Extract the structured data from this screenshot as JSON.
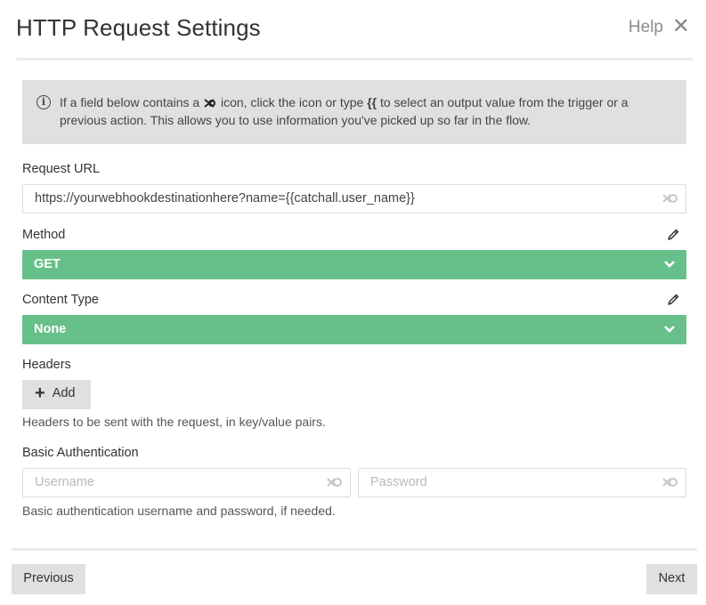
{
  "header": {
    "title": "HTTP Request Settings",
    "help_label": "Help",
    "close_glyph": "✕"
  },
  "info": {
    "text_before_icon": "If a field below contains a",
    "text_after_icon": "icon, click the icon or type",
    "brace_token": "{{",
    "text_after_braces": "to select an output value from the trigger or a previous action. This allows you to use information you've picked up so far in the flow."
  },
  "request_url": {
    "label": "Request URL",
    "value": "https://yourwebhookdestinationhere?name={{catchall.user_name}}"
  },
  "method": {
    "label": "Method",
    "selected": "GET"
  },
  "content_type": {
    "label": "Content Type",
    "selected": "None"
  },
  "headers": {
    "label": "Headers",
    "add_label": "Add",
    "hint": "Headers to be sent with the request, in key/value pairs."
  },
  "basic_auth": {
    "label": "Basic Authentication",
    "username_placeholder": "Username",
    "password_placeholder": "Password",
    "hint": "Basic authentication username and password, if needed."
  },
  "footer": {
    "previous_label": "Previous",
    "next_label": "Next"
  },
  "colors": {
    "select_bg": "#67c08a",
    "panel_bg": "#dfe1e0"
  }
}
